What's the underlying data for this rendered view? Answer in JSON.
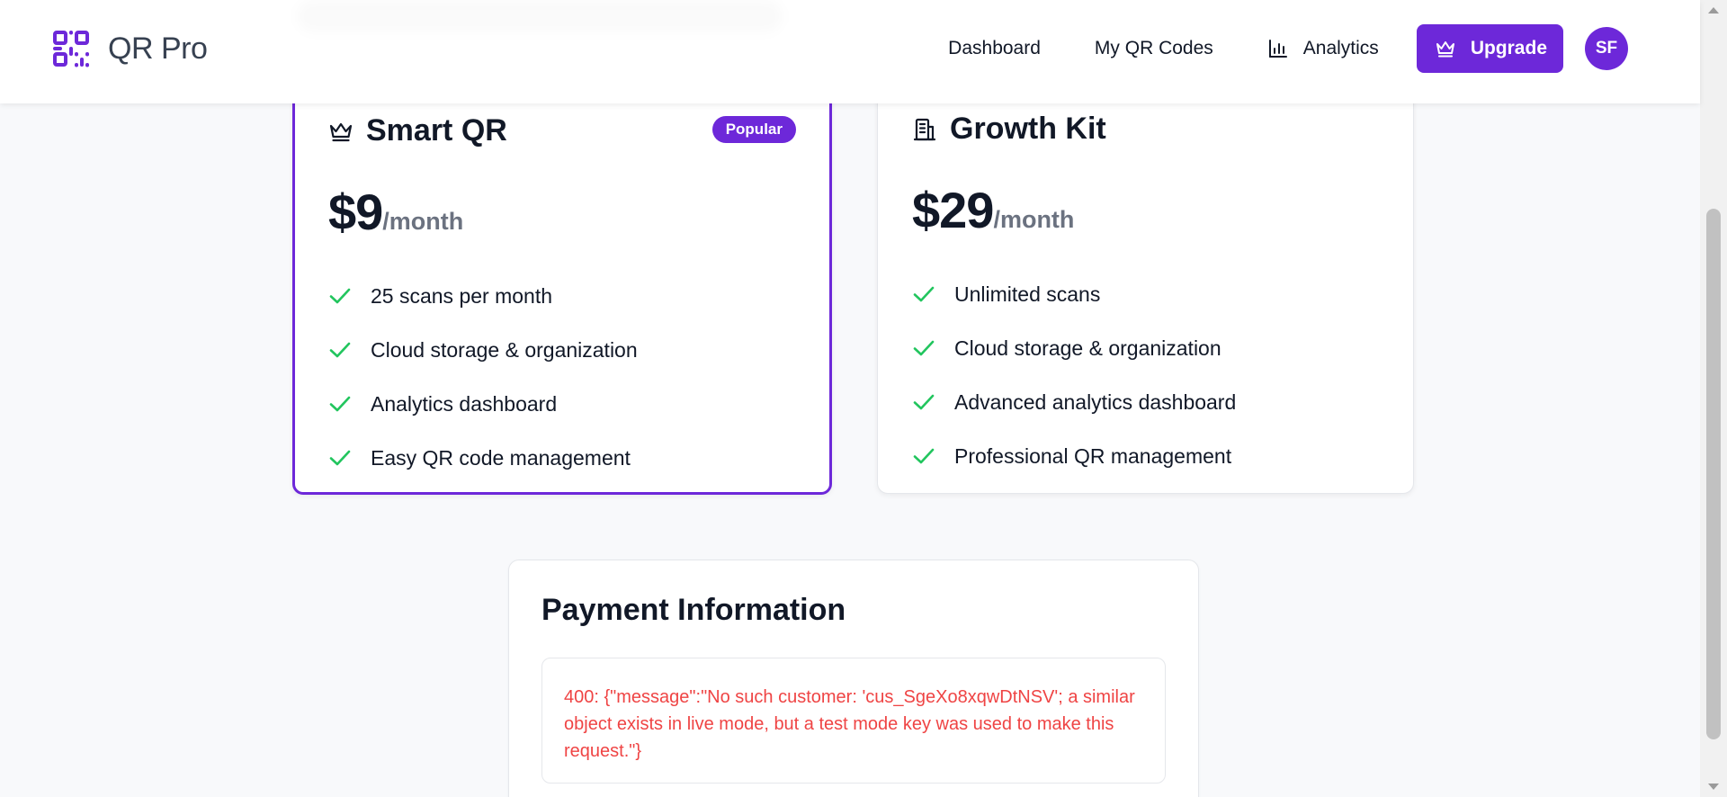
{
  "brand": {
    "name": "QR Pro",
    "icon": "qr-code-icon",
    "accent": "#6d28d9"
  },
  "nav": {
    "items": [
      {
        "label": "Dashboard"
      },
      {
        "label": "My QR Codes"
      },
      {
        "label": "Analytics",
        "icon": "bar-chart-icon"
      }
    ],
    "upgrade_label": "Upgrade",
    "upgrade_icon": "crown-icon",
    "avatar_initials": "SF"
  },
  "plans": [
    {
      "name": "Smart QR",
      "icon": "crown-icon",
      "badge": "Popular",
      "price": "$9",
      "period": "/month",
      "highlighted": true,
      "features": [
        "25 scans per month",
        "Cloud storage & organization",
        "Analytics dashboard",
        "Easy QR code management"
      ]
    },
    {
      "name": "Growth Kit",
      "icon": "building-icon",
      "price": "$29",
      "period": "/month",
      "highlighted": false,
      "features": [
        "Unlimited scans",
        "Cloud storage & organization",
        "Advanced analytics dashboard",
        "Professional QR management"
      ]
    }
  ],
  "payment": {
    "title": "Payment Information",
    "error": "400: {\"message\":\"No such customer: 'cus_SgeXo8xqwDtNSV'; a similar object exists in live mode, but a test mode key was used to make this request.\"}",
    "error_color": "#ef4444"
  },
  "colors": {
    "check": "#22c55e",
    "muted": "#6b7280"
  }
}
